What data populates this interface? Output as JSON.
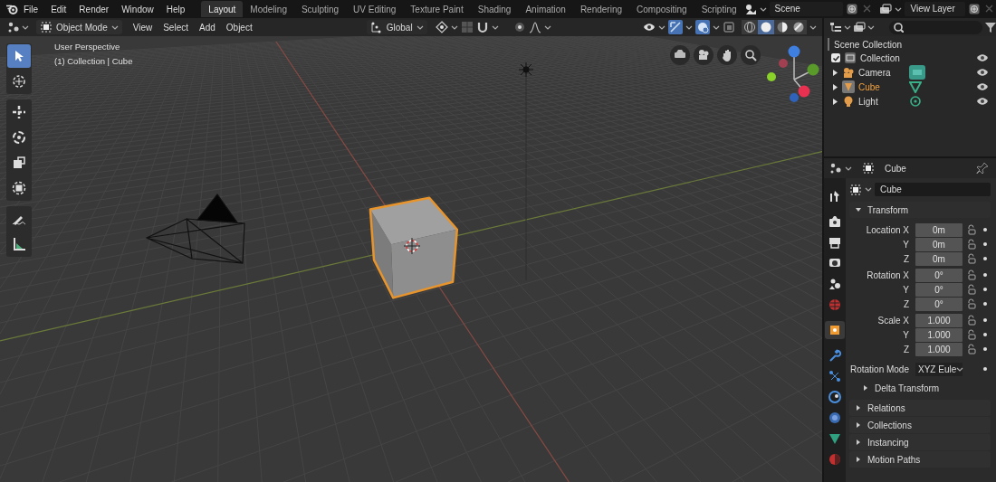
{
  "top_bar": {
    "menus": [
      "File",
      "Edit",
      "Render",
      "Window",
      "Help"
    ],
    "workspaces": [
      {
        "label": "Layout",
        "selected": true
      },
      {
        "label": "Modeling",
        "selected": false
      },
      {
        "label": "Sculpting",
        "selected": false
      },
      {
        "label": "UV Editing",
        "selected": false
      },
      {
        "label": "Texture Paint",
        "selected": false
      },
      {
        "label": "Shading",
        "selected": false
      },
      {
        "label": "Animation",
        "selected": false
      },
      {
        "label": "Rendering",
        "selected": false
      },
      {
        "label": "Compositing",
        "selected": false
      },
      {
        "label": "Scripting",
        "selected": false
      }
    ],
    "scene": "Scene",
    "view_layer": "View Layer"
  },
  "viewport_header": {
    "mode": "Object Mode",
    "menus": [
      "View",
      "Select",
      "Add",
      "Object"
    ],
    "orientation": "Global",
    "shading_modes": [
      {
        "kind": "wireframe",
        "selected": false
      },
      {
        "kind": "solid",
        "selected": true
      },
      {
        "kind": "material",
        "selected": false
      },
      {
        "kind": "rendered",
        "selected": false
      }
    ]
  },
  "viewport": {
    "view_name": "User Perspective",
    "context": "(1) Collection | Cube",
    "tools": [
      {
        "kind": "select",
        "selected": true
      },
      {
        "kind": "cursor",
        "selected": false
      },
      {
        "kind": "move",
        "selected": false
      },
      {
        "kind": "rotate",
        "selected": false
      },
      {
        "kind": "scale",
        "selected": false
      },
      {
        "kind": "transform",
        "selected": false
      },
      {
        "kind": "annotate",
        "selected": false
      },
      {
        "kind": "measure",
        "selected": false
      }
    ]
  },
  "outliner": {
    "title": "Scene Collection",
    "items": [
      {
        "label": "Collection",
        "kind": "collection",
        "checked": true,
        "selected": false,
        "children": [
          {
            "label": "Camera",
            "kind": "camera",
            "selected": false
          },
          {
            "label": "Cube",
            "kind": "mesh",
            "selected": true
          },
          {
            "label": "Light",
            "kind": "light",
            "selected": false
          }
        ]
      }
    ]
  },
  "properties": {
    "context": "Cube",
    "tabs": [
      {
        "kind": "tool",
        "selected": false
      },
      {
        "kind": "render",
        "selected": false
      },
      {
        "kind": "output",
        "selected": false
      },
      {
        "kind": "view_layer",
        "selected": false
      },
      {
        "kind": "scene",
        "selected": false
      },
      {
        "kind": "world",
        "selected": false
      },
      {
        "kind": "object",
        "selected": true
      },
      {
        "kind": "modifiers",
        "selected": false
      },
      {
        "kind": "particles",
        "selected": false
      },
      {
        "kind": "physics",
        "selected": false
      },
      {
        "kind": "constraints",
        "selected": false
      },
      {
        "kind": "data",
        "selected": false
      },
      {
        "kind": "material",
        "selected": false
      }
    ],
    "object_name": "Cube",
    "panels": [
      {
        "title": "Transform",
        "expanded": true,
        "rows": [
          {
            "kind": "field",
            "label": "Location X",
            "value": "0m"
          },
          {
            "kind": "field",
            "label": "Y",
            "value": "0m"
          },
          {
            "kind": "field",
            "label": "Z",
            "value": "0m"
          },
          {
            "kind": "field",
            "label": "Rotation X",
            "value": "0°"
          },
          {
            "kind": "field",
            "label": "Y",
            "value": "0°"
          },
          {
            "kind": "field",
            "label": "Z",
            "value": "0°"
          },
          {
            "kind": "field",
            "label": "Scale X",
            "value": "1.000"
          },
          {
            "kind": "field",
            "label": "Y",
            "value": "1.000"
          },
          {
            "kind": "field",
            "label": "Z",
            "value": "1.000"
          },
          {
            "kind": "dropdown",
            "label": "Rotation Mode",
            "value": "XYZ Eule"
          }
        ],
        "subpanels": [
          {
            "title": "Delta Transform",
            "expanded": false
          }
        ]
      },
      {
        "title": "Relations",
        "expanded": false
      },
      {
        "title": "Collections",
        "expanded": false
      },
      {
        "title": "Instancing",
        "expanded": false
      },
      {
        "title": "Motion Paths",
        "expanded": false
      }
    ]
  }
}
